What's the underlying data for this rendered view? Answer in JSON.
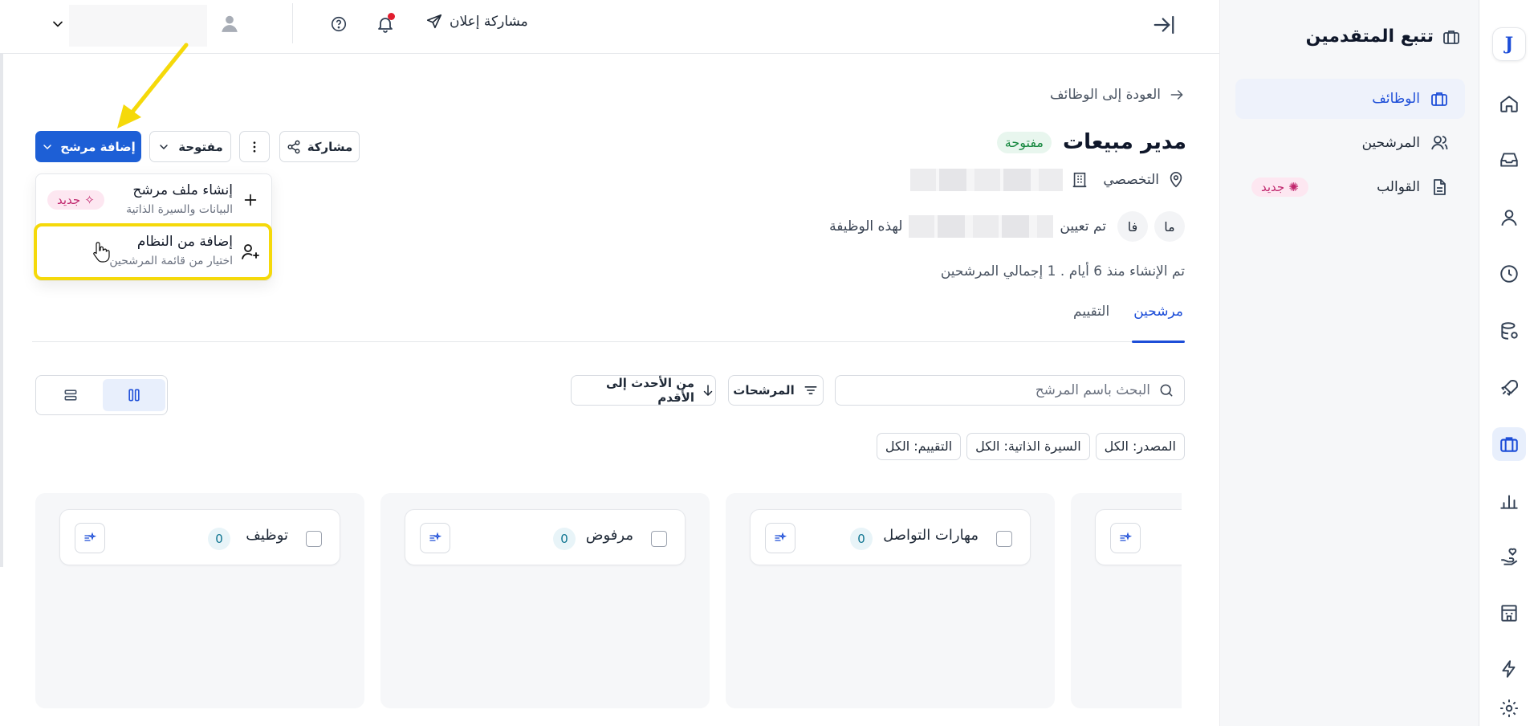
{
  "app": {
    "title": "تتبع المتقدمين",
    "logo": "J"
  },
  "rail": {
    "icons": [
      "home-icon",
      "inbox-icon",
      "user-icon",
      "clock-icon",
      "database-icon",
      "rocket-icon",
      "briefcase-icon",
      "chart-icon",
      "hand-heart-icon",
      "building-icon",
      "bolt-icon",
      "settings-icon"
    ],
    "active": "briefcase-icon"
  },
  "sidebar": {
    "items": [
      {
        "label": "الوظائف",
        "icon": "briefcase-icon",
        "active": true
      },
      {
        "label": "المرشحين",
        "icon": "users-icon",
        "active": false
      },
      {
        "label": "القوالب",
        "icon": "document-icon",
        "active": false,
        "badge": "جديد"
      }
    ]
  },
  "topbar": {
    "share_ad": "مشاركة إعلان",
    "icons": [
      "collapse-sidebar-icon",
      "send-icon",
      "bell-icon",
      "help-icon",
      "avatar-icon",
      "chevron-down-icon"
    ],
    "notification_color": "#e11d2e"
  },
  "job": {
    "back_label": "العودة إلى الوظائف",
    "title": "مدير مبيعات",
    "status": "مفتوحة",
    "location": "التخصصي",
    "assigned_prefix": "تم تعيين",
    "assigned_suffix": "لهذه الوظيفة",
    "assignees": [
      "ما",
      "فا"
    ],
    "created_text": "تم الإنشاء منذ 6 أيام . 1 إجمالي المرشحين"
  },
  "actions": {
    "add_candidate": "إضافة مرشح",
    "status_value": "مفتوحة",
    "share": "مشاركة",
    "primary_color": "#1d5fd6"
  },
  "dropdown": {
    "items": [
      {
        "title": "إنشاء ملف مرشح",
        "subtitle": "البيانات والسيرة الذاتية",
        "badge": "جديد",
        "icon": "plus-icon"
      },
      {
        "title": "إضافة من النظام",
        "subtitle": "اختيار من قائمة المرشحين",
        "icon": "user-plus-icon",
        "highlighted": true
      }
    ],
    "highlight_color": "#f5d90a"
  },
  "tabs": [
    {
      "label": "مرشحين",
      "active": true
    },
    {
      "label": "التقييم",
      "active": false
    }
  ],
  "toolbar": {
    "search_placeholder": "البحث باسم المرشح",
    "filters_label": "المرشحات",
    "sort_label": "من الأحدث إلى الأقدم",
    "views": [
      "kanban-view-icon",
      "list-view-icon"
    ],
    "active_view": "kanban-view-icon"
  },
  "chips": [
    "المصدر: الكل",
    "السيرة الذاتية: الكل",
    "التقييم: الكل"
  ],
  "board": {
    "columns": [
      {
        "label": "مهارات التواصل",
        "count": "0"
      },
      {
        "label": "مرفوض",
        "count": "0"
      },
      {
        "label": "توظيف",
        "count": "0"
      }
    ]
  }
}
